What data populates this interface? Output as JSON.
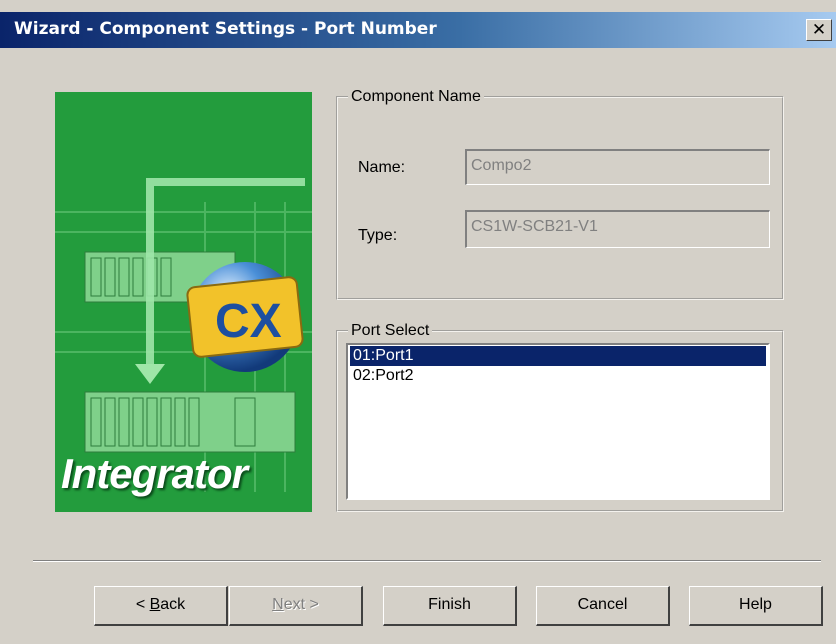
{
  "window": {
    "title": "Wizard - Component Settings - Port Number",
    "close_glyph": "✕",
    "colors": {
      "titlebar_start": "#0a246a",
      "titlebar_end": "#a6caf0",
      "face": "#d4d0c8",
      "selection": "#0a246a"
    }
  },
  "image": {
    "brand_text": "Integrator",
    "logo_text": "CX"
  },
  "component_name": {
    "legend": "Component Name",
    "name_label": "Name:",
    "name_value": "Compo2",
    "type_label": "Type:",
    "type_value": "CS1W-SCB21-V1"
  },
  "port_select": {
    "legend": "Port Select",
    "items": [
      {
        "label": "01:Port1",
        "selected": true
      },
      {
        "label": "02:Port2",
        "selected": false
      }
    ]
  },
  "buttons": {
    "back_prefix": "< ",
    "back_mnemonic": "B",
    "back_rest": "ack",
    "next_mnemonic": "N",
    "next_rest": "ext >",
    "finish": "Finish",
    "cancel": "Cancel",
    "help": "Help"
  }
}
